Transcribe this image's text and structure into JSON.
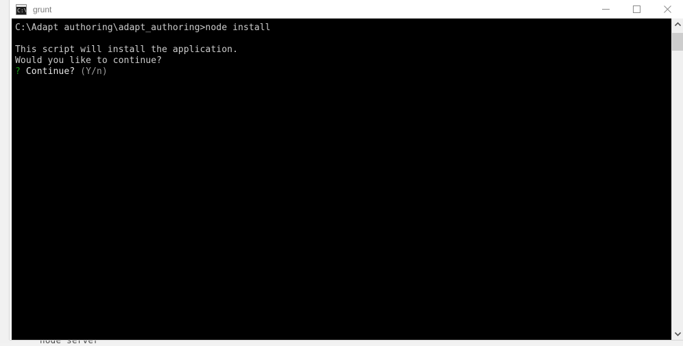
{
  "window": {
    "title": "grunt",
    "icon": "console-icon",
    "icon_prompt": "C:\\_",
    "controls": {
      "minimize_label": "Minimize",
      "maximize_label": "Maximize",
      "close_label": "Close"
    }
  },
  "terminal": {
    "background_color": "#000000",
    "text_color": "#cccccc",
    "prompt_color": "#15a015",
    "dim_color": "#9a9a9a",
    "lines": [
      {
        "segments": [
          {
            "text": "C:\\Adapt authoring\\adapt_authoring>node install",
            "style": "default"
          }
        ]
      },
      {
        "segments": [
          {
            "text": "",
            "style": "default"
          }
        ]
      },
      {
        "segments": [
          {
            "text": "This script will install the application.",
            "style": "default"
          }
        ]
      },
      {
        "segments": [
          {
            "text": "Would you like to continue?",
            "style": "default"
          }
        ]
      },
      {
        "segments": [
          {
            "text": "?",
            "style": "green"
          },
          {
            "text": " Continue? ",
            "style": "bright"
          },
          {
            "text": "(Y/n)",
            "style": "dim"
          }
        ]
      }
    ]
  },
  "scrollbar": {
    "up_arrow": "chevron-up-icon",
    "down_arrow": "chevron-down-icon",
    "thumb_position_percent": 1,
    "thumb_size_percent": 6
  },
  "background_window": {
    "visible_text": "node server"
  }
}
